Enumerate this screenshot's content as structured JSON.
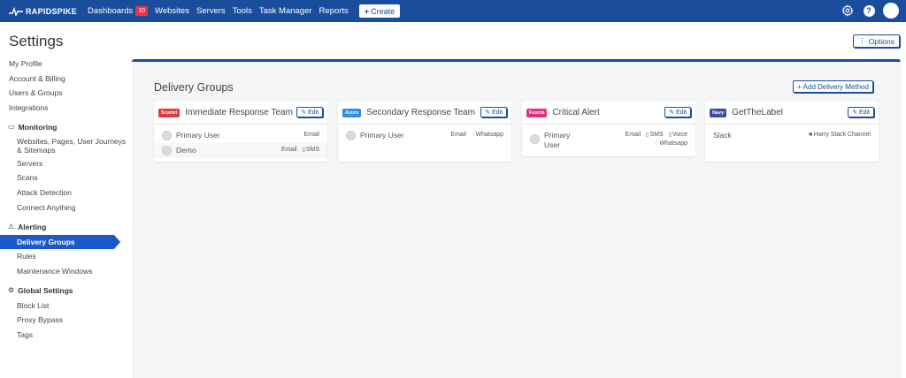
{
  "nav": {
    "logo": "RAPIDSPIKE",
    "items": [
      {
        "label": "Dashboards",
        "badge": "10"
      },
      {
        "label": "Websites"
      },
      {
        "label": "Servers"
      },
      {
        "label": "Tools"
      },
      {
        "label": "Task Manager"
      },
      {
        "label": "Reports"
      }
    ],
    "create_label": "Create",
    "help_label": "?"
  },
  "page": {
    "title": "Settings",
    "options_label": "Options"
  },
  "sidebar": {
    "top_items": [
      "My Profile",
      "Account & Billing",
      "Users & Groups",
      "Integrations"
    ],
    "monitoring": {
      "label": "Monitoring",
      "items": [
        "Websites, Pages, User Journeys & Sitemaps",
        "Servers",
        "Scans",
        "Attack Detection",
        "Connect Anything"
      ]
    },
    "alerting": {
      "label": "Alerting",
      "items": [
        "Delivery Groups",
        "Rules",
        "Maintenance Windows"
      ]
    },
    "global": {
      "label": "Global Settings",
      "items": [
        "Block List",
        "Proxy Bypass",
        "Tags"
      ]
    }
  },
  "main": {
    "title": "Delivery Groups",
    "add_label": "Add Delivery Method",
    "edit_label": "Edit",
    "cards": [
      {
        "tag": "Scarlet",
        "tag_color": "#e03a3a",
        "title": "Immediate Response Team",
        "rows": [
          {
            "name": "Primary User",
            "m1": "Email",
            "m2": "",
            "m3": "",
            "m4": ""
          },
          {
            "name": "Demo",
            "m1": "Email",
            "m2": "SMS",
            "m3": "",
            "m4": ""
          }
        ]
      },
      {
        "tag": "Azure",
        "tag_color": "#2f8de4",
        "title": "Secondary Response Team",
        "rows": [
          {
            "name": "Primary User",
            "m1": "Email",
            "m2": "Whatsapp",
            "m3": "",
            "m4": ""
          }
        ]
      },
      {
        "tag": "Fuscia",
        "tag_color": "#e0307f",
        "title": "Critical Alert",
        "rows": [
          {
            "name": "Primary User",
            "m1": "Email",
            "m2": "SMS",
            "m3": "Voice",
            "m4": "Whatsapp"
          }
        ]
      },
      {
        "tag": "Navy",
        "tag_color": "#3b4aa8",
        "title": "GetTheLabel",
        "rows": [
          {
            "name": "Slack",
            "m1": "Harry Slack Channel",
            "m2": "",
            "m3": "",
            "m4": ""
          }
        ]
      }
    ]
  }
}
